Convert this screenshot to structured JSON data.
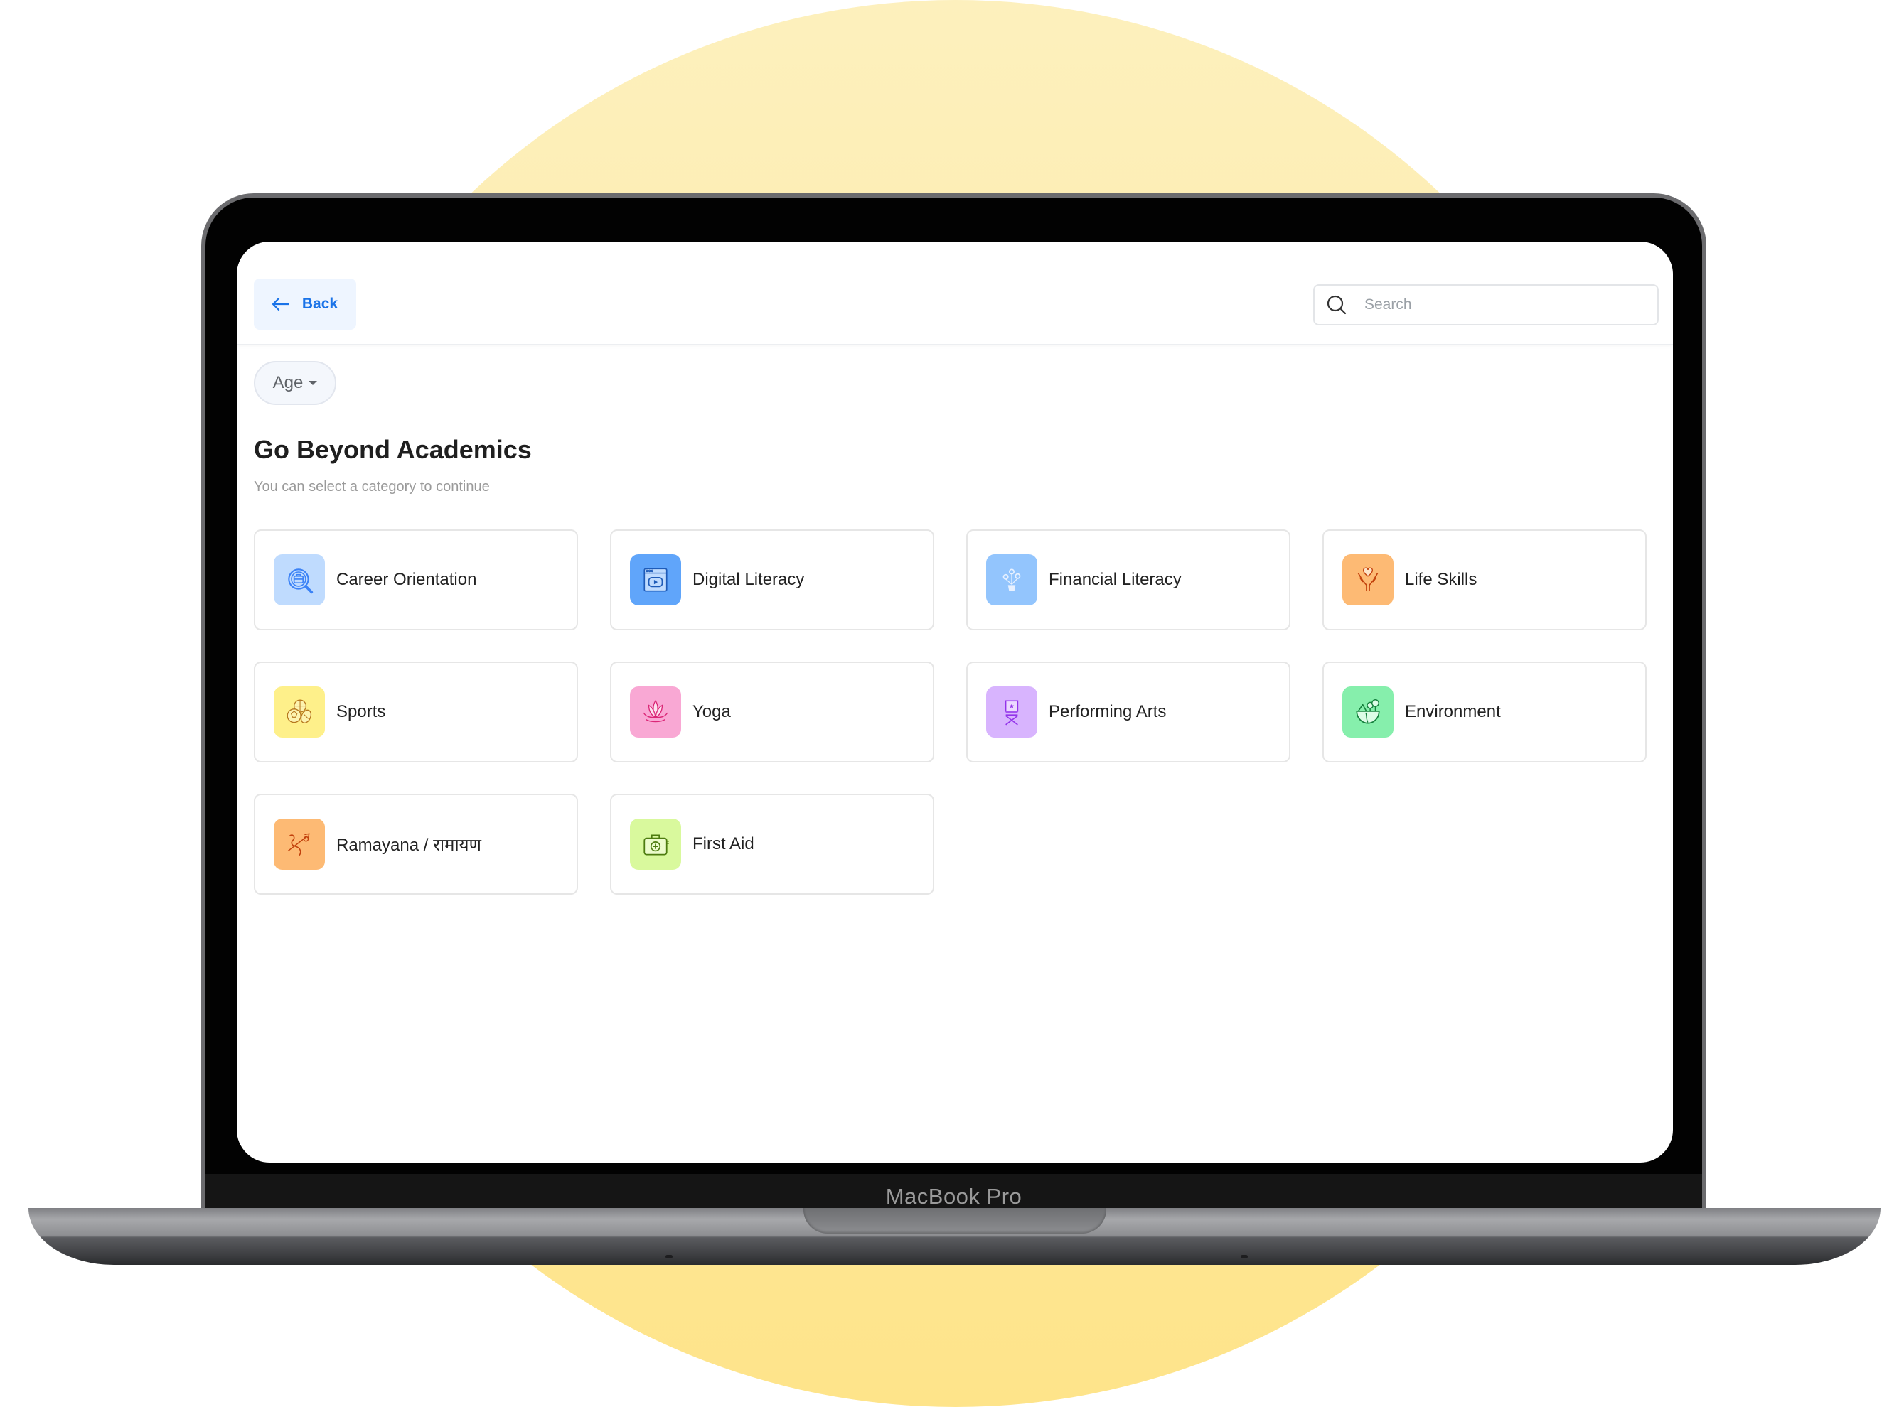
{
  "device": {
    "brand_label": "MacBook Pro"
  },
  "header": {
    "back_label": "Back",
    "search_placeholder": "Search",
    "search_value": ""
  },
  "filters": {
    "age_label": "Age"
  },
  "page": {
    "title": "Go Beyond Academics",
    "subtitle": "You can select a category to continue"
  },
  "categories": [
    {
      "label": "Career Orientation",
      "icon": "career-search-icon",
      "bg": "#bfdbfe",
      "stroke": "#3b82f6"
    },
    {
      "label": "Digital Literacy",
      "icon": "video-browser-icon",
      "bg": "#60a5fa",
      "stroke": "#1e5bb8"
    },
    {
      "label": "Financial Literacy",
      "icon": "money-plant-icon",
      "bg": "#93c5fd",
      "stroke": "#e8f1ff"
    },
    {
      "label": "Life Skills",
      "icon": "hands-heart-icon",
      "bg": "#fdba74",
      "stroke": "#c2410c"
    },
    {
      "label": "Sports",
      "icon": "sports-balls-icon",
      "bg": "#fef08a",
      "stroke": "#b7791f"
    },
    {
      "label": "Yoga",
      "icon": "lotus-icon",
      "bg": "#f9a8d4",
      "stroke": "#db2777"
    },
    {
      "label": "Performing Arts",
      "icon": "director-chair-icon",
      "bg": "#d8b4fe",
      "stroke": "#9333ea"
    },
    {
      "label": "Environment",
      "icon": "earth-trees-icon",
      "bg": "#86efac",
      "stroke": "#15803d"
    },
    {
      "label": "Ramayana / रामायण",
      "icon": "bow-arrow-icon",
      "bg": "#fdba74",
      "stroke": "#c2410c"
    },
    {
      "label": "First Aid",
      "icon": "first-aid-kit-icon",
      "bg": "#d9f99d",
      "stroke": "#4d7c0f"
    }
  ]
}
